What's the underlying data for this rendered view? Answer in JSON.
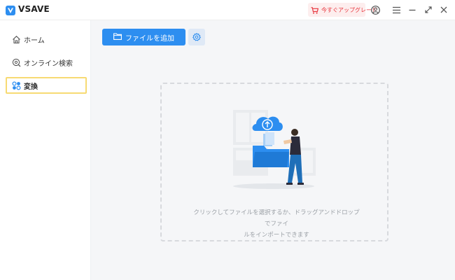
{
  "app": {
    "title": "VSAVE",
    "accent_color": "#2d8ef0",
    "highlight_color": "#f7da73"
  },
  "titlebar": {
    "upgrade_label": "今すぐアップグレード",
    "icons": [
      "cart-icon",
      "user-icon",
      "menu-icon",
      "minimize-icon",
      "maximize-icon",
      "close-icon"
    ]
  },
  "sidebar": {
    "items": [
      {
        "label": "ホーム",
        "icon": "home-icon",
        "active": false
      },
      {
        "label": "オンライン検索",
        "icon": "search-icon",
        "active": false
      },
      {
        "label": "変換",
        "icon": "convert-icon",
        "active": true
      }
    ]
  },
  "toolbar": {
    "add_file_label": "ファイルを追加",
    "settings_icon": "gear-icon"
  },
  "drop_zone": {
    "hint_line1": "クリックしてファイルを選択するか、ドラッグアンドドロップでファイ",
    "hint_line2": "ルをインポートできます"
  }
}
